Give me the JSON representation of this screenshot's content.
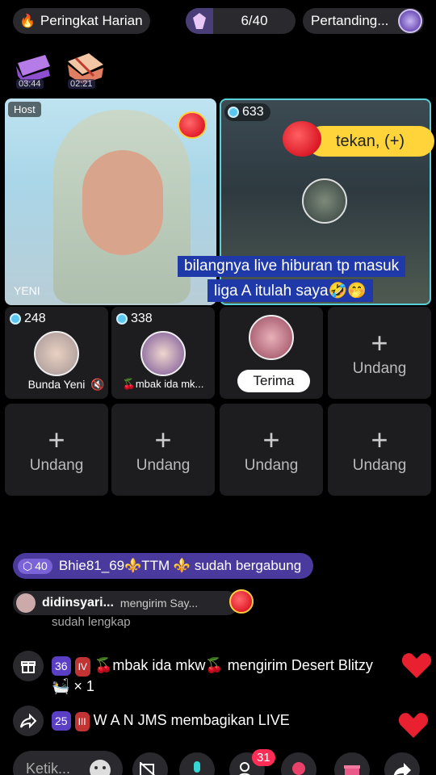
{
  "header": {
    "daily_rank_label": "Peringkat Harian",
    "counter": "6/40",
    "match_label": "Pertanding..."
  },
  "chests": [
    {
      "time": "03:44"
    },
    {
      "time": "02:21"
    }
  ],
  "host_tile": {
    "role": "Host",
    "name": "YENI"
  },
  "guest_tile": {
    "score": "633"
  },
  "tekan_label": "tekan, (+)",
  "caption": {
    "line1": "bilangnya live hiburan tp masuk",
    "line2": "liga A  itulah saya🤣🤭"
  },
  "guests": [
    {
      "score": "248",
      "name": "Bunda Yeni"
    },
    {
      "score": "338",
      "name": "🍒mbak ida mk..."
    },
    {
      "accept_label": "Terima"
    },
    {
      "invite_label": "Undang"
    }
  ],
  "invites": [
    "Undang",
    "Undang",
    "Undang",
    "Undang"
  ],
  "join_notice": {
    "level": "40",
    "text": "Bhie81_69⚜️TTM ⚜️ sudah bergabung"
  },
  "gift_notice": {
    "user": "didinsyari...",
    "action": "mengirim Say..."
  },
  "cut_text": "sudah lengkap",
  "comments": [
    {
      "level": "36",
      "badge": "IV",
      "text": "🍒mbak ida mkw🍒 mengirim Desert Blitzy 🛀 × 1"
    },
    {
      "level": "25",
      "badge": "III",
      "text": "W A N JMS membagikan LIVE"
    }
  ],
  "bottom": {
    "input_placeholder": "Ketik...",
    "participants_count": "31"
  },
  "colors": {
    "accent": "#5ad0d8",
    "caption_bg": "#1f3aa8",
    "join_bg": "#4b3a9e",
    "like": "#e8202f"
  }
}
